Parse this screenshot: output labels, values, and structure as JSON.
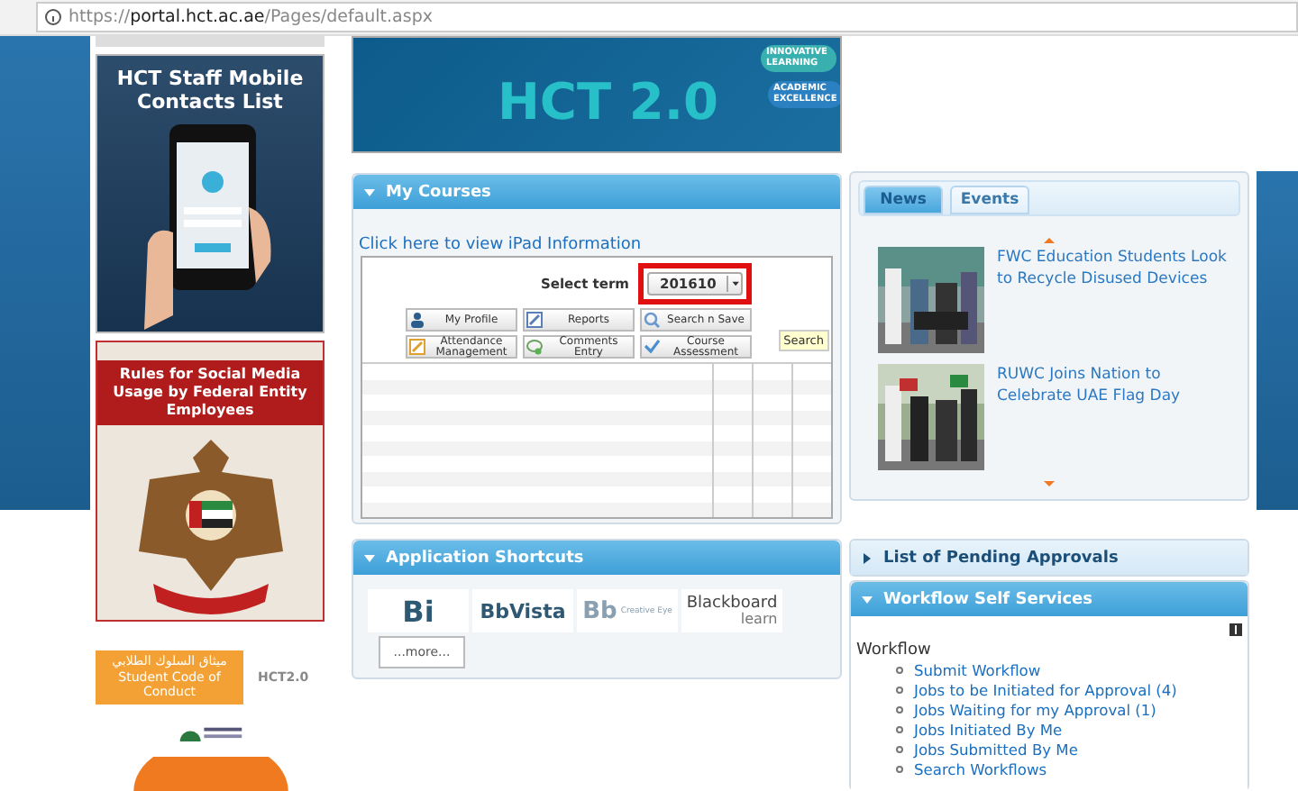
{
  "browser": {
    "scheme": "https://",
    "host": "portal.hct.ac.ae",
    "path": "/Pages/default.aspx"
  },
  "sidebar": {
    "mobile_ad": {
      "title": "HCT Staff Mobile Contacts List"
    },
    "social_ad": {
      "title": "Rules for Social Media Usage by Federal Entity Employees"
    },
    "conduct_badge": {
      "arabic": "ميثاق السلوك الطلابي",
      "english": "Student Code of Conduct"
    },
    "hct_mark": "HCT2.0"
  },
  "banner": {
    "title": "HCT 2.0",
    "tags": [
      "INNOVATIVE LEARNING",
      "ACADEMIC EXCELLENCE"
    ]
  },
  "my_courses": {
    "title": "My Courses",
    "expanded": true,
    "ipad_link": "Click here to view iPad Information",
    "term_label": "Select term",
    "term_value": "201610",
    "buttons": [
      {
        "label": "My Profile",
        "kind": "person"
      },
      {
        "label": "Reports",
        "kind": "report"
      },
      {
        "label": "Search n Save",
        "kind": "search"
      },
      {
        "label": "Attendance Management",
        "kind": "edit"
      },
      {
        "label": "Comments Entry",
        "kind": "comment"
      },
      {
        "label": "Course Assessment",
        "kind": "check"
      }
    ],
    "tooltip": "Search"
  },
  "shortcuts": {
    "title": "Application Shortcuts",
    "expanded": true,
    "apps": [
      {
        "kind": "bi",
        "name": "Bi"
      },
      {
        "kind": "vista",
        "name": "BbVista"
      },
      {
        "kind": "creative",
        "name": "Bb",
        "sub": "Creative Eye"
      },
      {
        "kind": "learn",
        "name": "Blackboard",
        "sub": "learn"
      }
    ],
    "more": "...more..."
  },
  "news": {
    "tabs": [
      {
        "label": "News",
        "selected": true
      },
      {
        "label": "Events",
        "selected": false
      }
    ],
    "items": [
      {
        "title": "FWC Education Students Look to Recycle Disused Devices",
        "kind": "picture"
      },
      {
        "title": "RUWC Joins Nation to Celebrate UAE Flag Day",
        "kind": "picture"
      }
    ]
  },
  "pending": {
    "title": "List of Pending Approvals",
    "expanded": false
  },
  "workflow": {
    "title": "Workflow Self Services",
    "expanded": true,
    "section": "Workflow",
    "items": [
      "Submit Workflow",
      "Jobs to be Initiated for Approval (4)",
      "Jobs Waiting for my Approval (1)",
      "Jobs Initiated By Me",
      "Jobs Submitted By Me",
      "Search Workflows"
    ]
  }
}
